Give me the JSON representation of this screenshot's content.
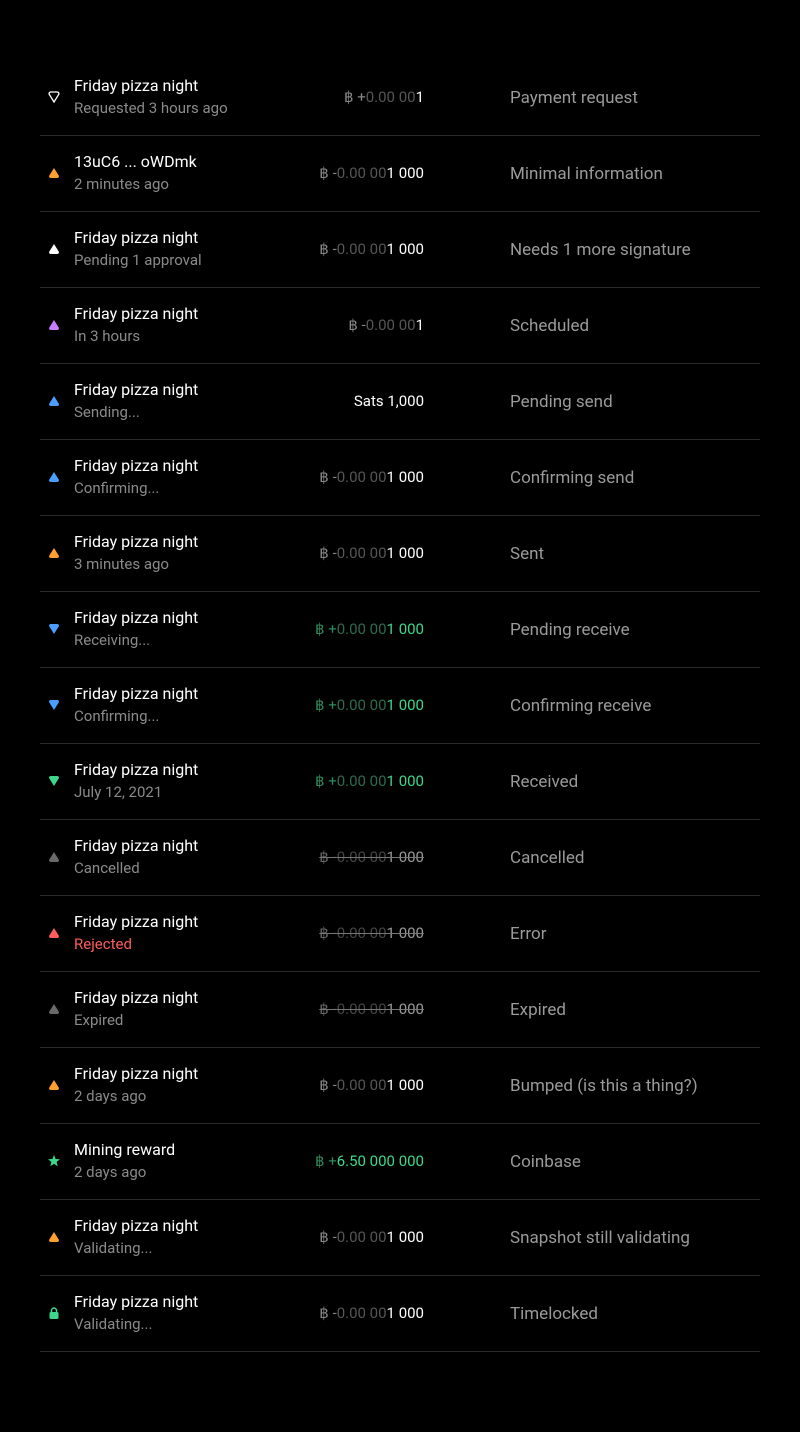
{
  "rows": [
    {
      "icon": "triangle-down-outline",
      "iconColor": "#ffffff",
      "title": "Friday pizza night",
      "subtitle": "Requested 3 hours ago",
      "amount": {
        "type": "btc",
        "sign": "+",
        "leading": "0.00 00",
        "trailing": "1",
        "style": "white-short"
      },
      "desc": "Payment request"
    },
    {
      "icon": "triangle-up",
      "iconColor": "#ff9f2e",
      "title": "13uC6 ... oWDmk",
      "subtitle": "2 minutes ago",
      "amount": {
        "type": "btc",
        "sign": "-",
        "leading": "0.00 00",
        "trailing": "1 000",
        "style": "white"
      },
      "desc": "Minimal information"
    },
    {
      "icon": "triangle-up",
      "iconColor": "#ffffff",
      "title": "Friday pizza night",
      "subtitle": "Pending 1 approval",
      "amount": {
        "type": "btc",
        "sign": "-",
        "leading": "0.00 00",
        "trailing": "1 000",
        "style": "white"
      },
      "desc": "Needs 1 more signature"
    },
    {
      "icon": "triangle-up",
      "iconColor": "#c77dff",
      "title": "Friday pizza night",
      "subtitle": "In 3 hours",
      "amount": {
        "type": "btc",
        "sign": "-",
        "leading": "0.00 00",
        "trailing": "1",
        "style": "white-short"
      },
      "desc": "Scheduled"
    },
    {
      "icon": "triangle-up",
      "iconColor": "#4a9eff",
      "title": "Friday pizza night",
      "subtitle": "Sending...",
      "amount": {
        "type": "sats",
        "text": "Sats 1,000"
      },
      "desc": "Pending send"
    },
    {
      "icon": "triangle-up",
      "iconColor": "#4a9eff",
      "title": "Friday pizza night",
      "subtitle": "Confirming...",
      "amount": {
        "type": "btc",
        "sign": "-",
        "leading": "0.00 00",
        "trailing": "1 000",
        "style": "white"
      },
      "desc": "Confirming send"
    },
    {
      "icon": "triangle-up",
      "iconColor": "#ff9f2e",
      "title": "Friday pizza night",
      "subtitle": "3 minutes ago",
      "amount": {
        "type": "btc",
        "sign": "-",
        "leading": "0.00 00",
        "trailing": "1 000",
        "style": "white"
      },
      "desc": "Sent"
    },
    {
      "icon": "triangle-down",
      "iconColor": "#4a9eff",
      "title": "Friday pizza night",
      "subtitle": "Receiving...",
      "amount": {
        "type": "btc",
        "sign": "+",
        "leading": "0.00 00",
        "trailing": "1 000",
        "style": "green"
      },
      "desc": "Pending receive"
    },
    {
      "icon": "triangle-down",
      "iconColor": "#4a9eff",
      "title": "Friday pizza night",
      "subtitle": "Confirming...",
      "amount": {
        "type": "btc",
        "sign": "+",
        "leading": "0.00 00",
        "trailing": "1 000",
        "style": "green"
      },
      "desc": "Confirming receive"
    },
    {
      "icon": "triangle-down",
      "iconColor": "#3dd68c",
      "title": "Friday pizza night",
      "subtitle": "July 12, 2021",
      "amount": {
        "type": "btc",
        "sign": "+",
        "leading": "0.00 00",
        "trailing": "1 000",
        "style": "green"
      },
      "desc": "Received"
    },
    {
      "icon": "triangle-up",
      "iconColor": "#6a6a6a",
      "title": "Friday pizza night",
      "subtitle": "Cancelled",
      "amount": {
        "type": "btc",
        "sign": "-",
        "leading": "0.00 00",
        "trailing": "1 000",
        "style": "strike"
      },
      "desc": "Cancelled"
    },
    {
      "icon": "triangle-up",
      "iconColor": "#ff5c5c",
      "title": "Friday pizza night",
      "subtitle": "Rejected",
      "subtitleClass": "red",
      "amount": {
        "type": "btc",
        "sign": "-",
        "leading": "0.00 00",
        "trailing": "1 000",
        "style": "strike"
      },
      "desc": "Error"
    },
    {
      "icon": "triangle-up",
      "iconColor": "#6a6a6a",
      "title": "Friday pizza night",
      "subtitle": "Expired",
      "amount": {
        "type": "btc",
        "sign": "-",
        "leading": "0.00 00",
        "trailing": "1 000",
        "style": "strike"
      },
      "desc": "Expired"
    },
    {
      "icon": "triangle-up",
      "iconColor": "#ff9f2e",
      "title": "Friday pizza night",
      "subtitle": "2 days ago",
      "amount": {
        "type": "btc",
        "sign": "-",
        "leading": "0.00 00",
        "trailing": "1 000",
        "style": "white"
      },
      "desc": "Bumped (is this a thing?)"
    },
    {
      "icon": "star",
      "iconColor": "#3dd68c",
      "title": "Mining reward",
      "subtitle": "2 days ago",
      "amount": {
        "type": "btc",
        "sign": "+",
        "leading": "",
        "trailing": "6.50 000 000",
        "style": "green"
      },
      "desc": "Coinbase"
    },
    {
      "icon": "triangle-up",
      "iconColor": "#ff9f2e",
      "title": "Friday pizza night",
      "subtitle": "Validating...",
      "amount": {
        "type": "btc",
        "sign": "-",
        "leading": "0.00 00",
        "trailing": "1 000",
        "style": "white"
      },
      "desc": "Snapshot still validating"
    },
    {
      "icon": "lock",
      "iconColor": "#3dd68c",
      "title": "Friday pizza night",
      "subtitle": "Validating...",
      "amount": {
        "type": "btc",
        "sign": "-",
        "leading": "0.00 00",
        "trailing": "1 000",
        "style": "white"
      },
      "desc": "Timelocked"
    }
  ]
}
